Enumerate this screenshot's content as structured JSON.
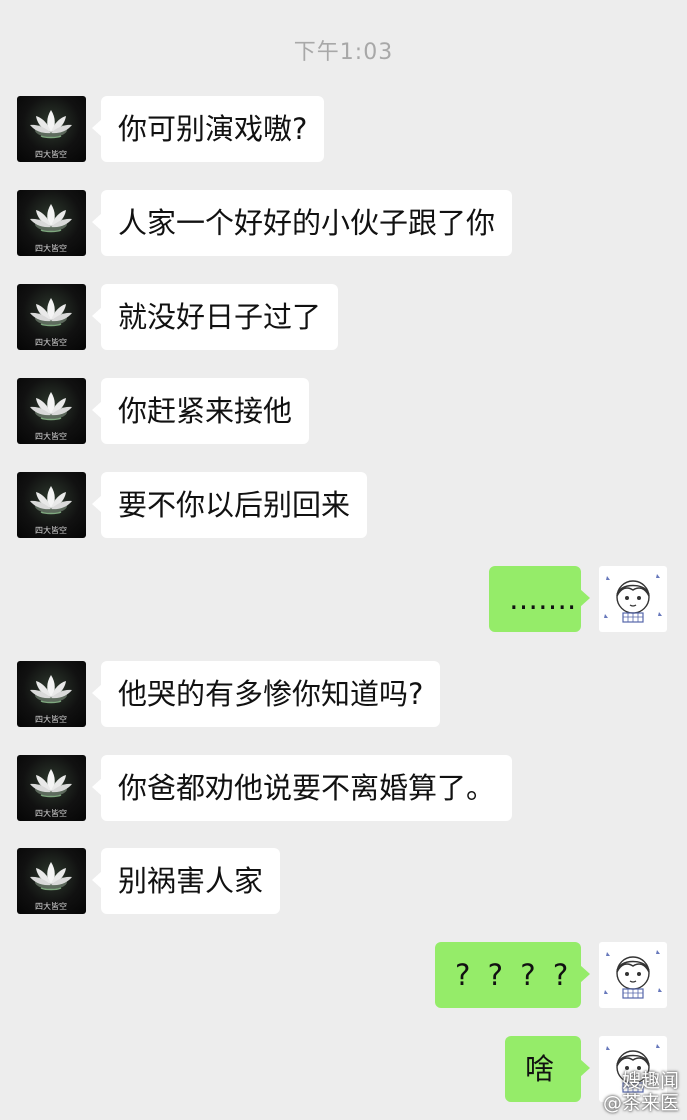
{
  "chat": {
    "timestamp": "下午1:03",
    "contact_avatar_caption": "四大皆空",
    "messages": [
      {
        "side": "in",
        "text": "你可别演戏嗷?"
      },
      {
        "side": "in",
        "text": "人家一个好好的小伙子跟了你"
      },
      {
        "side": "in",
        "text": "就没好日子过了"
      },
      {
        "side": "in",
        "text": "你赶紧来接他"
      },
      {
        "side": "in",
        "text": "要不你以后别回来"
      },
      {
        "side": "out",
        "text": "……."
      },
      {
        "side": "in",
        "text": "他哭的有多惨你知道吗?"
      },
      {
        "side": "in",
        "text": "你爸都劝他说要不离婚算了。"
      },
      {
        "side": "in",
        "text": "别祸害人家"
      },
      {
        "side": "out",
        "text": "? ? ? ?"
      },
      {
        "side": "out",
        "text": "啥"
      }
    ]
  },
  "watermark": {
    "line1": "嫂趣闻",
    "line2": "@茶来医"
  },
  "colors": {
    "background": "#ededed",
    "incoming_bubble": "#ffffff",
    "outgoing_bubble": "#95ec69",
    "timestamp_text": "#a8a8a8"
  }
}
